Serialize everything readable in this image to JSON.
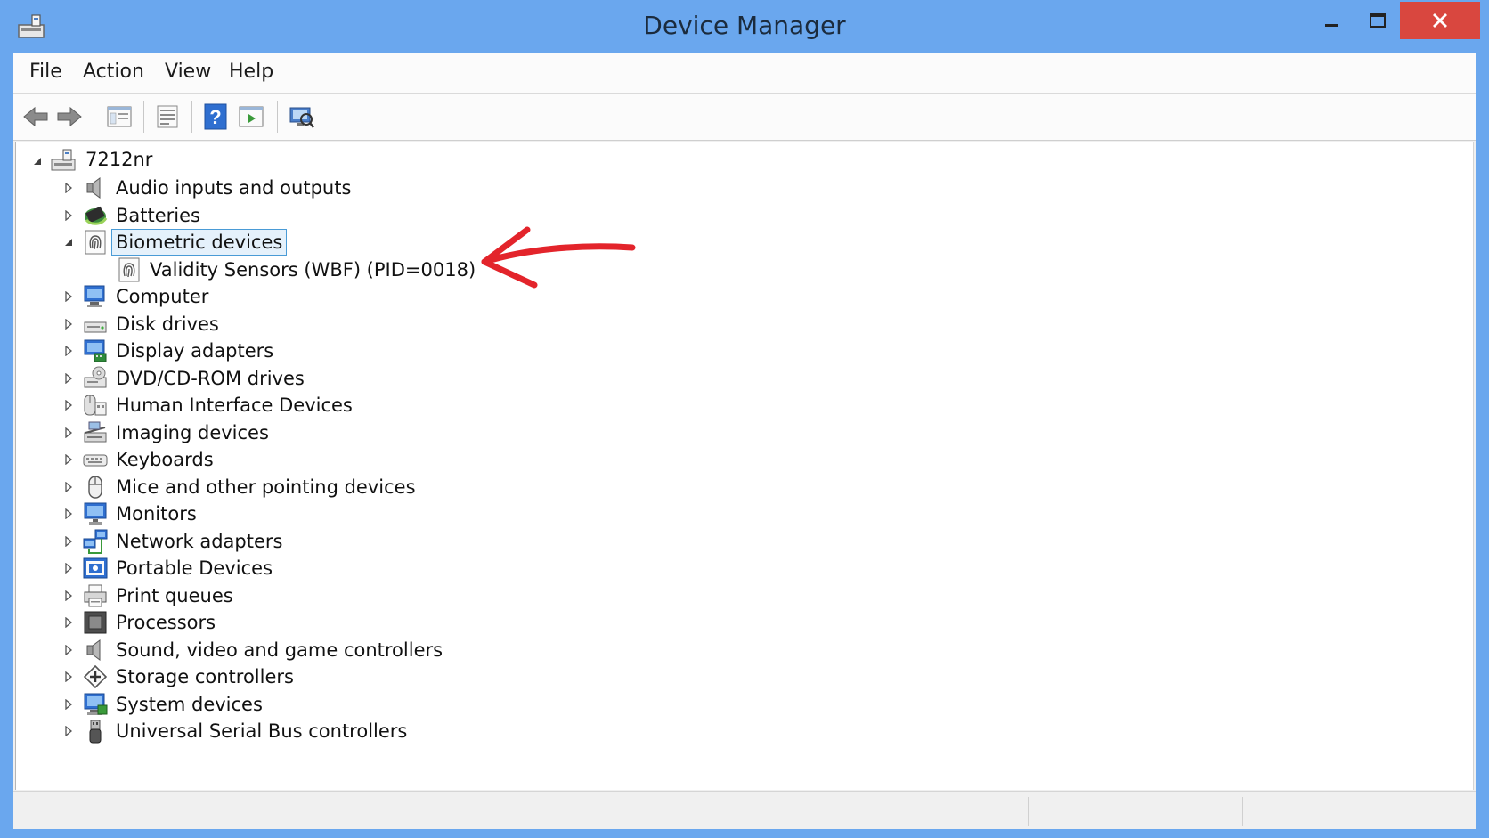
{
  "window": {
    "title": "Device Manager",
    "accent": "#6aa7ee",
    "close_color": "#d9473f"
  },
  "menu": [
    "File",
    "Action",
    "View",
    "Help"
  ],
  "toolbar": [
    "back-icon",
    "forward-icon",
    "properties-icon",
    "list-icon",
    "help-icon",
    "run-icon",
    "scan-hardware-icon"
  ],
  "tree": {
    "root": "7212nr",
    "categories": [
      {
        "label": "Audio inputs and outputs",
        "icon": "speaker-icon",
        "expanded": false
      },
      {
        "label": "Batteries",
        "icon": "battery-icon",
        "expanded": false
      },
      {
        "label": "Biometric devices",
        "icon": "fingerprint-icon",
        "expanded": true,
        "selected": true,
        "children": [
          {
            "label": "Validity Sensors (WBF) (PID=0018)",
            "icon": "fingerprint-icon"
          }
        ]
      },
      {
        "label": "Computer",
        "icon": "computer-icon",
        "expanded": false
      },
      {
        "label": "Disk drives",
        "icon": "disk-drive-icon",
        "expanded": false
      },
      {
        "label": "Display adapters",
        "icon": "display-adapter-icon",
        "expanded": false
      },
      {
        "label": "DVD/CD-ROM drives",
        "icon": "dvd-icon",
        "expanded": false
      },
      {
        "label": "Human Interface Devices",
        "icon": "hid-icon",
        "expanded": false
      },
      {
        "label": "Imaging devices",
        "icon": "scanner-icon",
        "expanded": false
      },
      {
        "label": "Keyboards",
        "icon": "keyboard-icon",
        "expanded": false
      },
      {
        "label": "Mice and other pointing devices",
        "icon": "mouse-icon",
        "expanded": false
      },
      {
        "label": "Monitors",
        "icon": "monitor-icon",
        "expanded": false
      },
      {
        "label": "Network adapters",
        "icon": "network-icon",
        "expanded": false
      },
      {
        "label": "Portable Devices",
        "icon": "portable-device-icon",
        "expanded": false
      },
      {
        "label": "Print queues",
        "icon": "printer-icon",
        "expanded": false
      },
      {
        "label": "Processors",
        "icon": "processor-icon",
        "expanded": false
      },
      {
        "label": "Sound, video and game controllers",
        "icon": "speaker-icon",
        "expanded": false
      },
      {
        "label": "Storage controllers",
        "icon": "storage-controller-icon",
        "expanded": false
      },
      {
        "label": "System devices",
        "icon": "system-icon",
        "expanded": false
      },
      {
        "label": "Universal Serial Bus controllers",
        "icon": "usb-icon",
        "expanded": false
      }
    ]
  }
}
